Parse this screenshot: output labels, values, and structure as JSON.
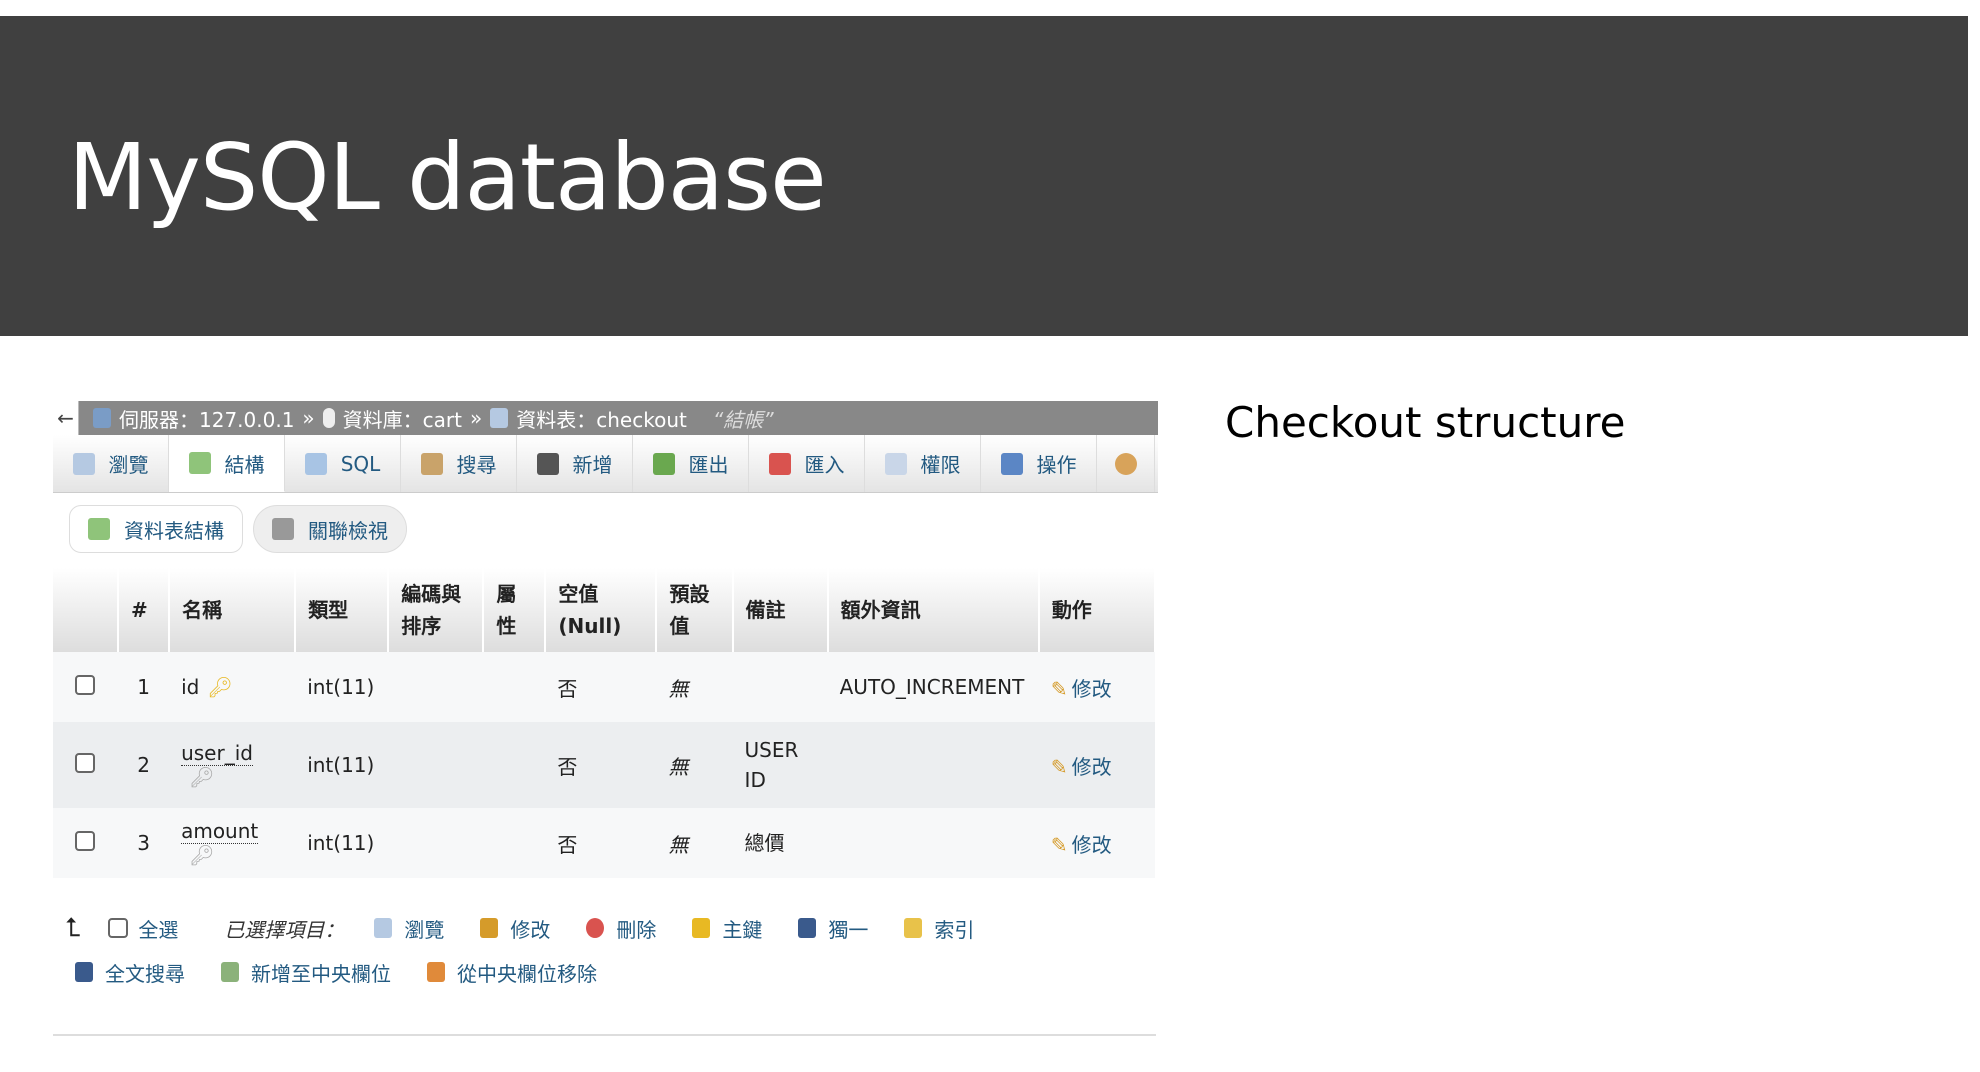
{
  "slide": {
    "title": "MySQL database",
    "side_title": "Checkout structure"
  },
  "breadcrumb": {
    "back": "←",
    "server": "伺服器：127.0.0.1",
    "sep": "»",
    "database": "資料庫：cart",
    "table": "資料表：checkout",
    "comment": "“結帳”"
  },
  "tabs": [
    {
      "label": "瀏覽",
      "icon": "browse-icon"
    },
    {
      "label": "結構",
      "icon": "structure-icon",
      "active": true
    },
    {
      "label": "SQL",
      "icon": "sql-icon"
    },
    {
      "label": "搜尋",
      "icon": "search-icon"
    },
    {
      "label": "新增",
      "icon": "insert-icon"
    },
    {
      "label": "匯出",
      "icon": "export-icon"
    },
    {
      "label": "匯入",
      "icon": "import-icon"
    },
    {
      "label": "權限",
      "icon": "privileges-icon"
    },
    {
      "label": "操作",
      "icon": "wrench-icon"
    },
    {
      "label": "",
      "icon": "eye-icon"
    }
  ],
  "subtabs": [
    "資料表結構",
    "關聯檢視"
  ],
  "columns": [
    "#",
    "名稱",
    "類型",
    "編碼與排序",
    "屬性",
    "空值 (Null)",
    "預設值",
    "備註",
    "額外資訊",
    "動作"
  ],
  "rows": [
    {
      "num": "1",
      "name": "id",
      "type": "int(11)",
      "collation": "",
      "attributes": "",
      "null": "否",
      "default": "無",
      "comment": "",
      "extra": "AUTO_INCREMENT",
      "action": "修改",
      "primary": true
    },
    {
      "num": "2",
      "name": "user_id",
      "type": "int(11)",
      "collation": "",
      "attributes": "",
      "null": "否",
      "default": "無",
      "comment": "USER ID",
      "extra": "",
      "action": "修改"
    },
    {
      "num": "3",
      "name": "amount",
      "type": "int(11)",
      "collation": "",
      "attributes": "",
      "null": "否",
      "default": "無",
      "comment": "總價",
      "extra": "",
      "action": "修改"
    }
  ],
  "footer": {
    "select_all": "全選",
    "with_selected": "已選擇項目：",
    "actions": [
      "瀏覽",
      "修改",
      "刪除",
      "主鍵",
      "獨一",
      "索引"
    ],
    "actions2": [
      "全文搜尋",
      "新增至中央欄位",
      "從中央欄位移除"
    ]
  }
}
